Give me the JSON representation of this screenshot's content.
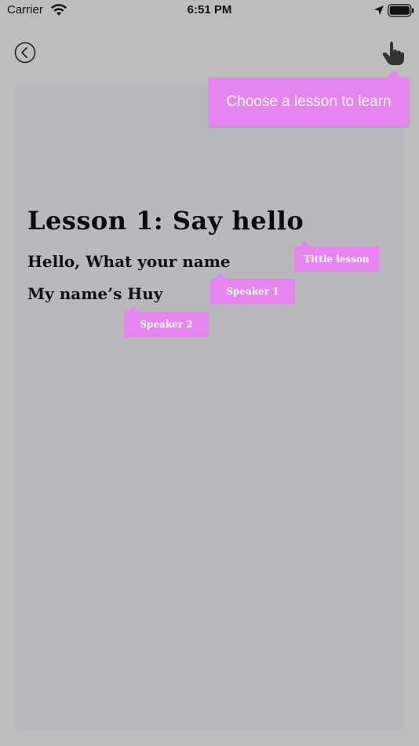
{
  "status_bar": {
    "carrier": "Carrier",
    "time": "6:51 PM",
    "icons": [
      "wifi-icon",
      "location-arrow-icon",
      "battery-icon"
    ]
  },
  "nav": {
    "back_icon": "chevron-left-circle-icon",
    "action_icon": "hand-pointer-icon"
  },
  "lesson": {
    "title": "Lesson 1: Say hello",
    "line1": "Hello, What your name",
    "line2": "My name’s Huy"
  },
  "tooltips": {
    "main": "Choose a lesson to learn",
    "title": "Tittle lesson",
    "speaker1": "Speaker 1",
    "speaker2": "Speaker 2"
  },
  "colors": {
    "background": "#bdbdbd",
    "panel": "#b9b9bb",
    "tooltip": "#e685ef",
    "tooltip_text": "#ffffff",
    "text": "#111111"
  }
}
